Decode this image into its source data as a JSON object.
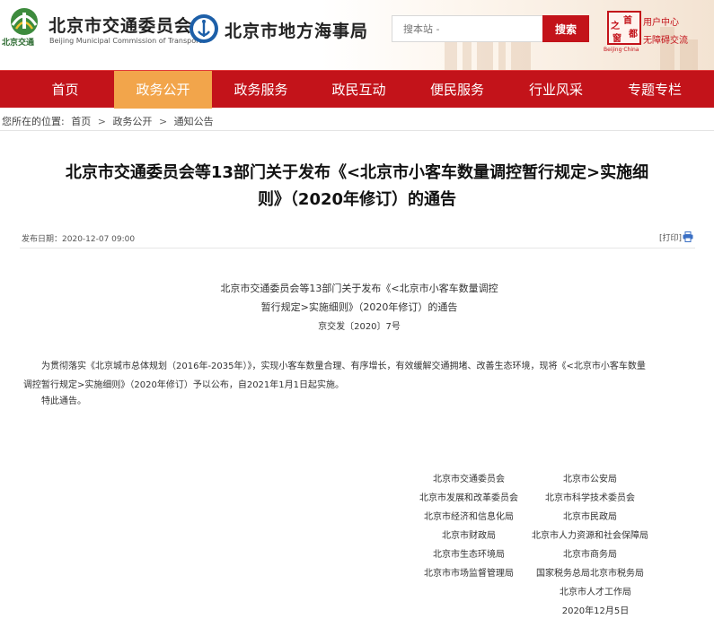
{
  "header": {
    "logo1_sub": "北京交通",
    "site1_title": "北京市交通委员会",
    "site1_en": "Beijing Municipal Commission of Transport",
    "site2_title": "北京市地方海事局",
    "search_placeholder": "搜本站 -",
    "search_label": "搜索",
    "stamp_chars": [
      "首",
      "都",
      "之",
      "窗"
    ],
    "stamp_sub": "Beijing·China",
    "user_center": "用户中心",
    "accessible": "无障碍交流"
  },
  "nav": {
    "items": [
      {
        "label": "首页",
        "active": false
      },
      {
        "label": "政务公开",
        "active": true
      },
      {
        "label": "政务服务",
        "active": false
      },
      {
        "label": "政民互动",
        "active": false
      },
      {
        "label": "便民服务",
        "active": false
      },
      {
        "label": "行业风采",
        "active": false
      },
      {
        "label": "专题专栏",
        "active": false
      }
    ]
  },
  "breadcrumb": {
    "prefix": "您所在的位置:",
    "items": [
      "首页",
      "政务公开",
      "通知公告"
    ],
    "separator": ">"
  },
  "article": {
    "title_line1": "北京市交通委员会等13部门关于发布《<北京市小客车数量调控暂行规定>实施细",
    "title_line2": "则》（2020年修订）的通告",
    "publish_label": "发布日期：",
    "publish_date": "2020-12-07 09:00",
    "print_label": "[打印]",
    "doc_head_line1": "北京市交通委员会等13部门关于发布《<北京市小客车数量调控",
    "doc_head_line2": "暂行规定>实施细则》（2020年修订）的通告",
    "doc_number": "京交发〔2020〕7号",
    "paragraph_line1": "为贯彻落实《北京城市总体规划（2016年-2035年）》，实现小客车数量合理、有序增长，有效缓解交通拥堵、改善生态环境，现将《<北京市小客车数量",
    "paragraph_line2": "调控暂行规定>实施细则》（2020年修订）予以公布，自2021年1月1日起实施。",
    "closing": "特此通告。"
  },
  "signatures": {
    "left": [
      "北京市交通委员会",
      "北京市发展和改革委员会",
      "北京市经济和信息化局",
      "北京市财政局",
      "北京市生态环境局",
      "北京市市场监督管理局"
    ],
    "right": [
      "北京市公安局",
      "北京市科学技术委员会",
      "北京市民政局",
      "北京市人力资源和社会保障局",
      "北京市商务局",
      "国家税务总局北京市税务局"
    ],
    "last": "北京市人才工作局",
    "date": "2020年12月5日"
  },
  "colors": {
    "primary_red": "#c3131a",
    "nav_active": "#f2a54b",
    "search_button": "#c3131a"
  }
}
